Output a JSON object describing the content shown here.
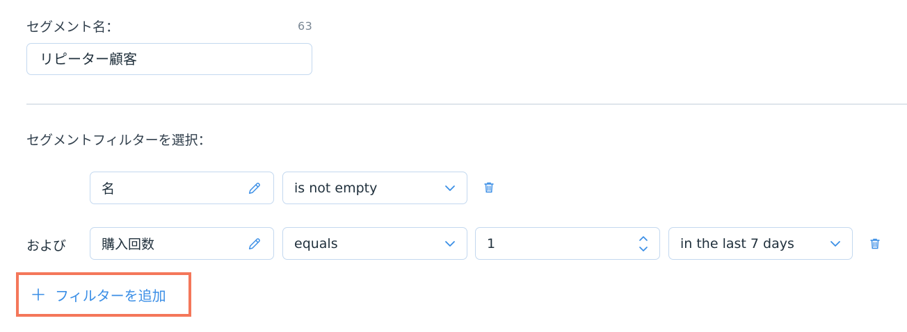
{
  "segment_name": {
    "label": "セグメント名：",
    "counter": "63",
    "value": "リピーター顧客"
  },
  "filters_section": {
    "label": "セグメントフィルターを選択：",
    "rows": [
      {
        "connector": "",
        "field": "名",
        "operator": "is not empty"
      },
      {
        "connector": "および",
        "field": "購入回数",
        "operator": "equals",
        "value": "1",
        "period": "in the last 7 days"
      }
    ],
    "add_filter_label": "フィルターを追加"
  },
  "colors": {
    "accent": "#3a8ee6",
    "highlight_border": "#f4775a",
    "input_border": "#c3d8ef"
  },
  "icons": [
    "pencil-icon",
    "chevron-down-icon",
    "trash-icon",
    "stepper-icon",
    "plus-icon"
  ]
}
